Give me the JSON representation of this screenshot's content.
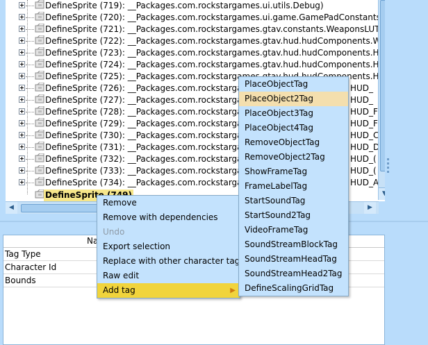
{
  "tree": {
    "rows": [
      {
        "label": "DefineSprite (719): __Packages.com.rockstargames.ui.utils.Debug)"
      },
      {
        "label": "DefineSprite (720): __Packages.com.rockstargames.ui.game.GamePadConstants)"
      },
      {
        "label": "DefineSprite (721): __Packages.com.rockstargames.gtav.constants.WeaponsLUT)"
      },
      {
        "label": "DefineSprite (722): __Packages.com.rockstargames.gtav.hud.hudComponents.Weapo"
      },
      {
        "label": "DefineSprite (723): __Packages.com.rockstargames.gtav.hud.hudComponents.HUD_w"
      },
      {
        "label": "DefineSprite (724): __Packages.com.rockstargames.gtav.hud.hudComponents.HUD_w"
      },
      {
        "label": "DefineSprite (725): __Packages.com.rockstargames.gtav.hud.hudComponents.HUD_S"
      },
      {
        "label": "DefineSprite (726): __Packages.com.rockstargame"
      },
      {
        "label": "DefineSprite (727): __Packages.com.rockstargame"
      },
      {
        "label": "DefineSprite (728): __Packages.com.rockstargame"
      },
      {
        "label": "DefineSprite (729): __Packages.com.rockstargame"
      },
      {
        "label": "DefineSprite (730): __Packages.com.rockstargame"
      },
      {
        "label": "DefineSprite (731): __Packages.com.rockstargame"
      },
      {
        "label": "DefineSprite (732): __Packages.com.rockstargame"
      },
      {
        "label": "DefineSprite (733): __Packages.com.rockstargame"
      },
      {
        "label": "DefineSprite (734): __Packages.com.rockstargame"
      }
    ],
    "selected_label": "DefineSprite (749)",
    "right_overflow": [
      "HUD_",
      "HUD_",
      "HUD_F",
      "HUD_F",
      "HUD_C",
      "HUD_D",
      "HUD_(",
      "HUD_(",
      "HUD_A",
      ""
    ]
  },
  "properties": {
    "header": "Na",
    "rows": [
      "Tag Type",
      "Character Id",
      "Bounds"
    ]
  },
  "context_menu": {
    "items": [
      {
        "label": "Remove",
        "disabled": false
      },
      {
        "label": "Remove with dependencies",
        "disabled": false
      },
      {
        "label": "Undo",
        "disabled": true
      },
      {
        "label": "Export selection",
        "disabled": false
      },
      {
        "label": "Replace with other character tag",
        "disabled": false
      },
      {
        "label": "Raw edit",
        "disabled": false
      },
      {
        "label": "Add tag",
        "disabled": false,
        "submenu": true
      }
    ]
  },
  "submenu": {
    "items": [
      "PlaceObjectTag",
      "PlaceObject2Tag",
      "PlaceObject3Tag",
      "PlaceObject4Tag",
      "RemoveObjectTag",
      "RemoveObject2Tag",
      "ShowFrameTag",
      "FrameLabelTag",
      "StartSoundTag",
      "StartSound2Tag",
      "VideoFrameTag",
      "SoundStreamBlockTag",
      "SoundStreamHeadTag",
      "SoundStreamHead2Tag",
      "DefineScalingGridTag"
    ],
    "hovered_index": 1
  },
  "colors": {
    "background": "#b9dcfb",
    "menu_bg": "#c3e2fd",
    "active_item": "#f1d43c",
    "hover_item": "#f4dfae",
    "selected_node": "#f6e68a"
  }
}
